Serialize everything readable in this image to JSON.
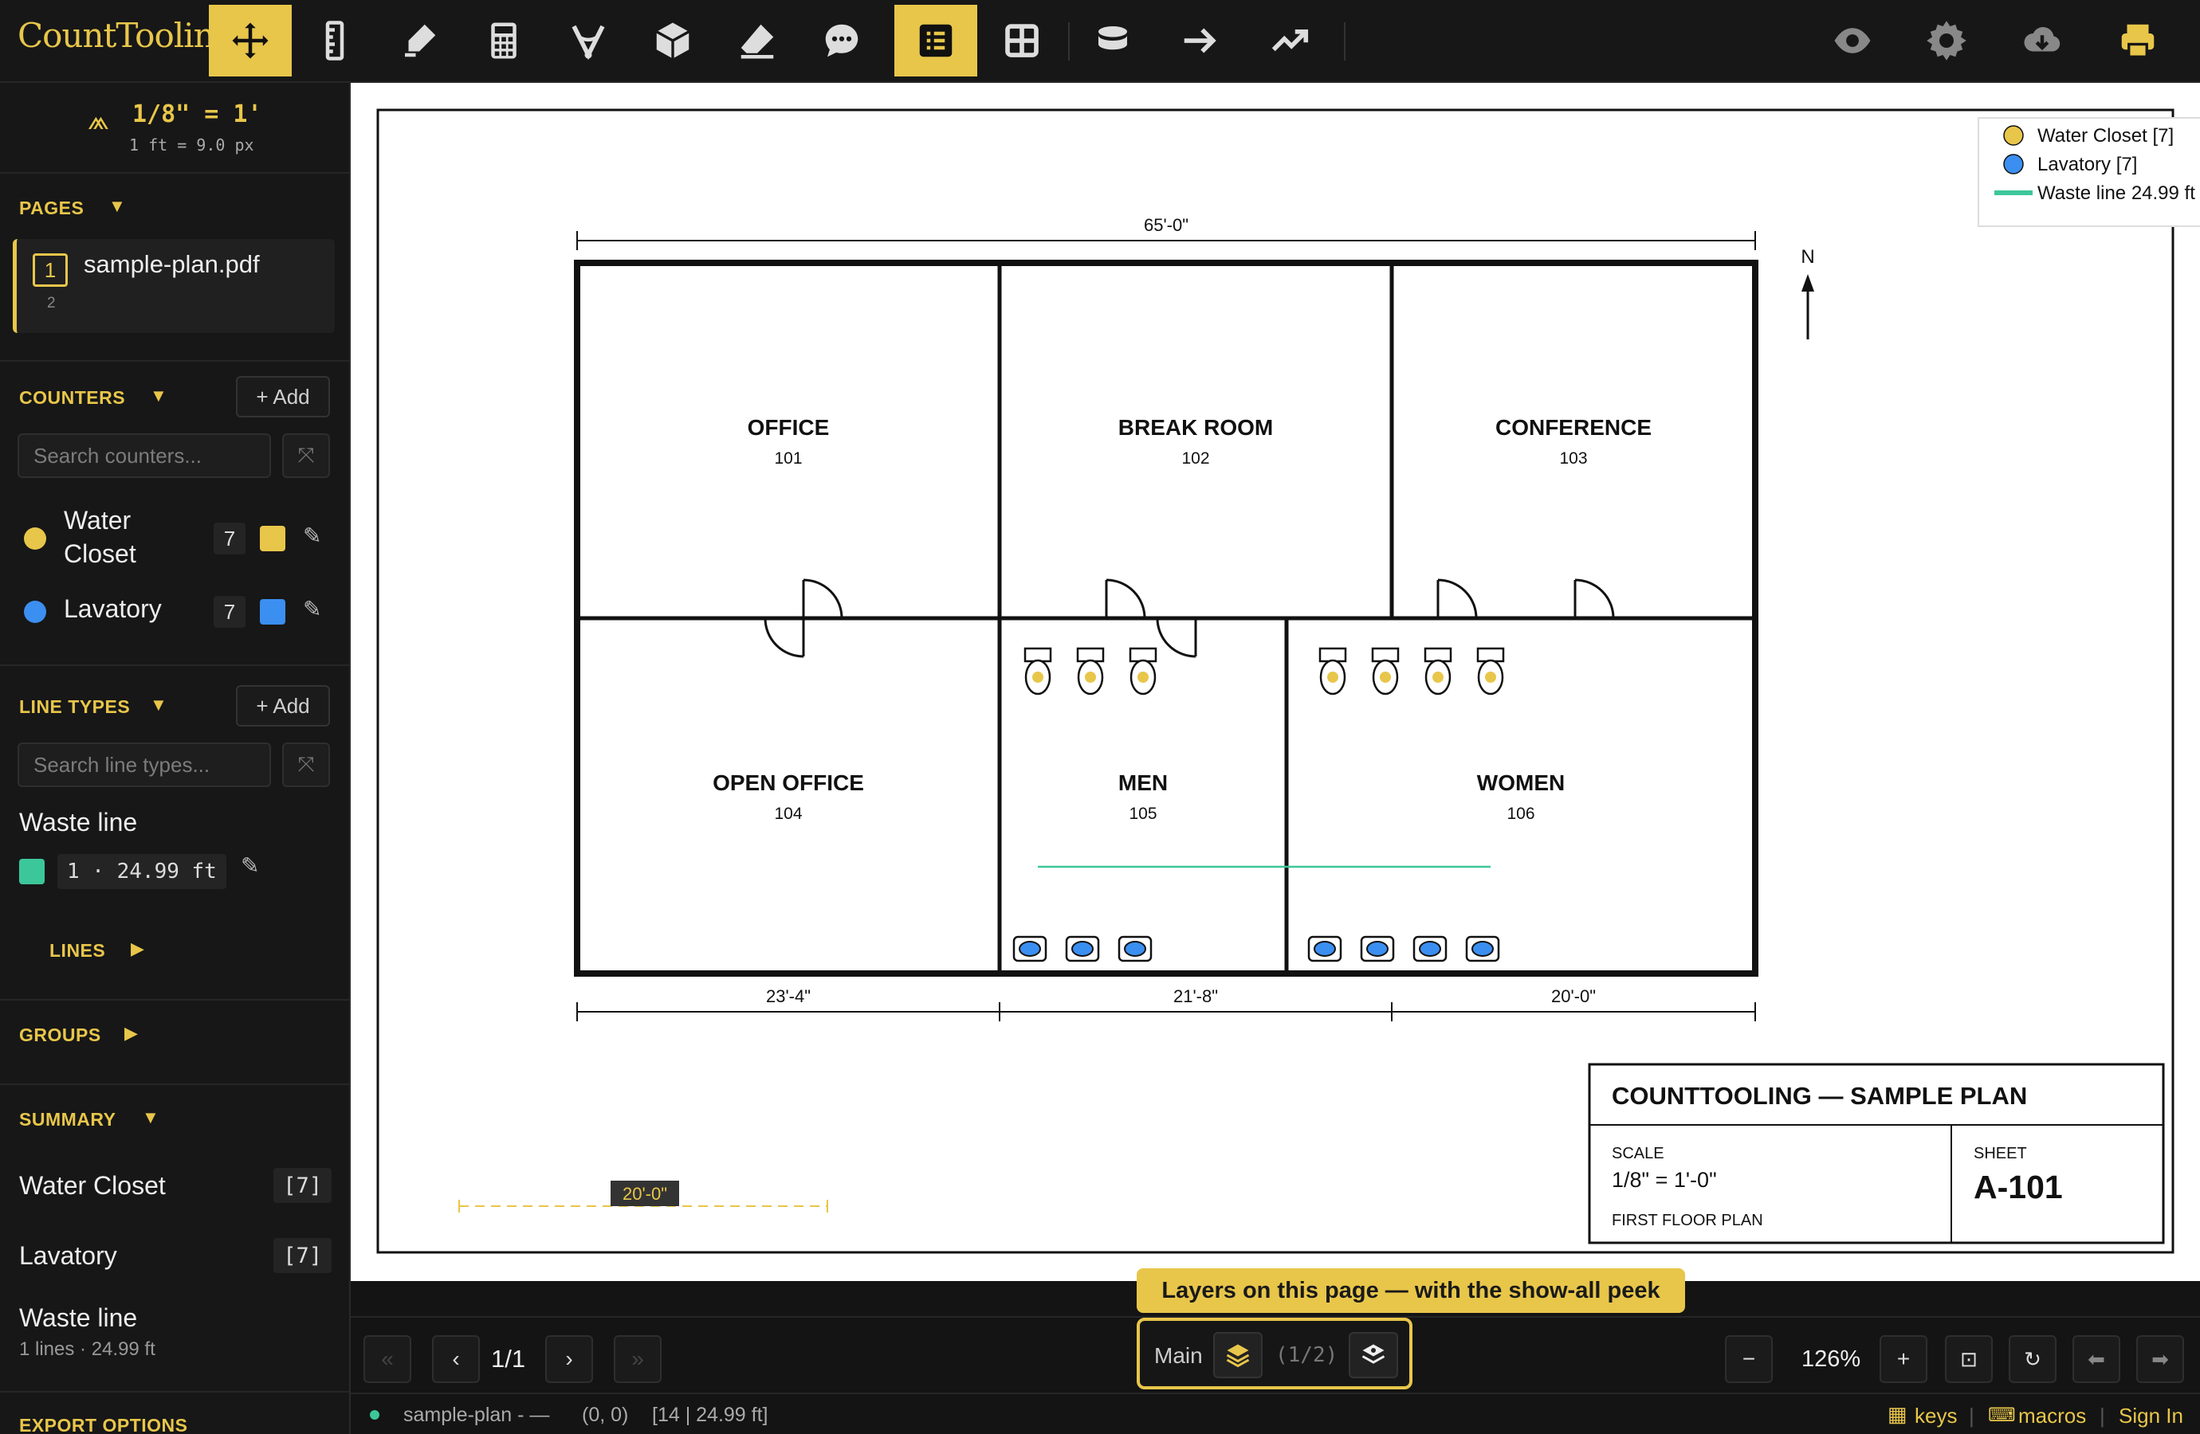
{
  "app": {
    "logo": "CountTooling"
  },
  "colors": {
    "accent": "#e8c64a",
    "water_closet": "#e8c64a",
    "lavatory": "#3b8ff0",
    "waste_line": "#3cc79a"
  },
  "toolbar": {
    "tools": [
      {
        "name": "move-icon",
        "active": true
      },
      {
        "name": "ruler-icon",
        "active": false
      },
      {
        "name": "highlighter-icon",
        "active": false
      },
      {
        "name": "calculator-icon",
        "active": false
      },
      {
        "name": "angle-icon",
        "active": false
      },
      {
        "name": "cube-icon",
        "active": false
      },
      {
        "name": "eraser-icon",
        "active": false
      },
      {
        "name": "comment-icon",
        "active": false
      },
      {
        "name": "list-icon",
        "active": true
      },
      {
        "name": "grid-icon",
        "active": false
      },
      {
        "name": "database-icon",
        "active": false
      },
      {
        "name": "arrow-right-icon",
        "active": false
      },
      {
        "name": "trend-icon",
        "active": false
      }
    ],
    "right": [
      "eye-icon",
      "gear-icon",
      "cloud-download-icon",
      "print-icon"
    ]
  },
  "scale": {
    "label": "1/8\" = 1'",
    "sub": "1 ft = 9.0 px"
  },
  "pages": {
    "title": "PAGES",
    "item_num": "1",
    "item_name": "sample-plan.pdf",
    "item_sub": "2"
  },
  "counters": {
    "title": "COUNTERS",
    "add": "+ Add",
    "search_placeholder": "Search counters...",
    "items": [
      {
        "name": "Water Closet",
        "count": "7"
      },
      {
        "name": "Lavatory",
        "count": "7"
      }
    ]
  },
  "line_types": {
    "title": "LINE TYPES",
    "add": "+ Add",
    "search_placeholder": "Search line types...",
    "item_name": "Waste line",
    "item_value": "1 · 24.99 ft",
    "lines_label": "LINES"
  },
  "groups": {
    "title": "GROUPS"
  },
  "summary": {
    "title": "SUMMARY",
    "items": [
      {
        "name": "Water Closet",
        "value": "[7]"
      },
      {
        "name": "Lavatory",
        "value": "[7]"
      },
      {
        "name": "Waste line",
        "sub": "1 lines · 24.99 ft"
      }
    ]
  },
  "export": {
    "title": "EXPORT OPTIONS"
  },
  "plan": {
    "legend": [
      "Water Closet [7]",
      "Lavatory [7]",
      "Waste line 24.99 ft"
    ],
    "dim_top": "65'-0\"",
    "dims_bottom": [
      "23'-4\"",
      "21'-8\"",
      "20'-0\""
    ],
    "north": "N",
    "rooms": [
      {
        "name": "OFFICE",
        "num": "101"
      },
      {
        "name": "BREAK ROOM",
        "num": "102"
      },
      {
        "name": "CONFERENCE",
        "num": "103"
      },
      {
        "name": "OPEN OFFICE",
        "num": "104"
      },
      {
        "name": "MEN",
        "num": "105"
      },
      {
        "name": "WOMEN",
        "num": "106"
      }
    ],
    "scale_bar": "20'-0\"",
    "title_block": {
      "title": "COUNTTOOLING — SAMPLE PLAN",
      "scale_label": "SCALE",
      "scale_value": "1/8\" = 1'-0\"",
      "sheet_label": "SHEET",
      "sheet_value": "A-101",
      "subtitle": "FIRST FLOOR PLAN"
    }
  },
  "bottom": {
    "first": "«",
    "prev": "‹",
    "page": "1/1",
    "next": "›",
    "last": "»",
    "layer_name": "Main",
    "layer_count": "(1/2)",
    "tooltip": "Layers on this page — with the show-all peek",
    "zoom_out": "−",
    "zoom": "126%",
    "zoom_in": "+"
  },
  "status": {
    "file": "sample-plan - —",
    "coords": "(0, 0)",
    "info": "[14 | 24.99 ft]",
    "keys": "keys",
    "macros": "macros",
    "sign_in": "Sign In"
  }
}
